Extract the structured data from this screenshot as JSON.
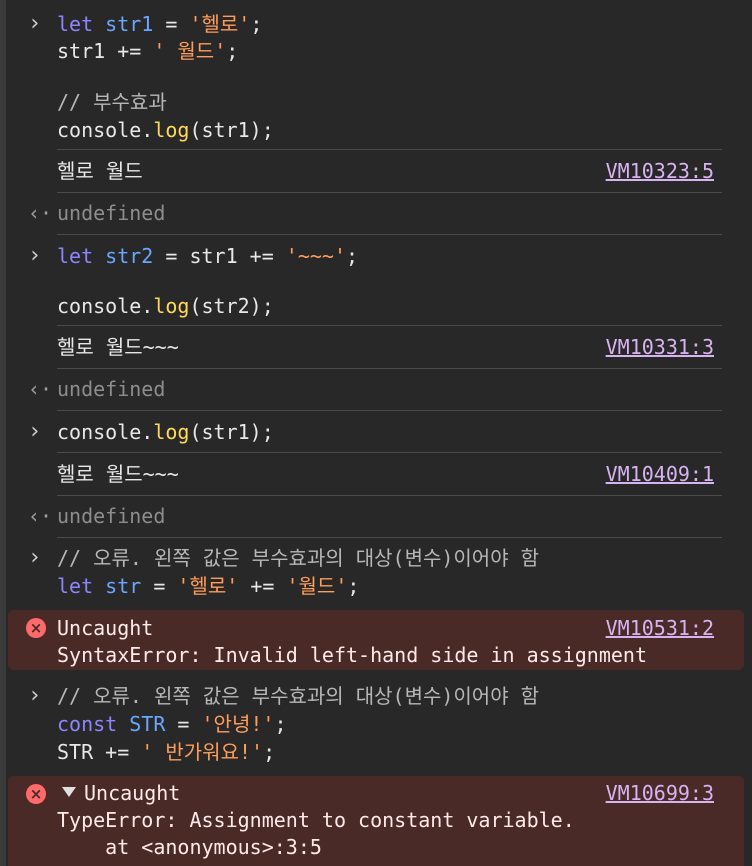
{
  "entries": [
    {
      "lines": [
        [
          [
            "let ",
            "kw"
          ],
          [
            "str1",
            "var"
          ],
          [
            " = ",
            ""
          ],
          [
            "'헬로'",
            "str"
          ],
          [
            ";",
            ""
          ]
        ],
        [
          [
            "str1 += ",
            ""
          ],
          [
            "' 월드'",
            "str"
          ],
          [
            ";",
            ""
          ]
        ],
        [
          [
            "",
            ""
          ]
        ],
        [
          [
            "// 부수효과",
            "cm"
          ]
        ],
        [
          [
            "console.",
            ""
          ],
          [
            "log",
            "fn"
          ],
          [
            "(str1);",
            ""
          ]
        ]
      ],
      "output": "헬로 월드",
      "source": "VM10323:5",
      "returned": "undefined"
    },
    {
      "lines": [
        [
          [
            "let ",
            "kw"
          ],
          [
            "str2",
            "var"
          ],
          [
            " = str1 += ",
            ""
          ],
          [
            "'~~~'",
            "str"
          ],
          [
            ";",
            ""
          ]
        ],
        [
          [
            "",
            ""
          ]
        ],
        [
          [
            "console.",
            ""
          ],
          [
            "log",
            "fn"
          ],
          [
            "(str2);",
            ""
          ]
        ]
      ],
      "output": "헬로 월드~~~",
      "source": "VM10331:3",
      "returned": "undefined"
    },
    {
      "lines": [
        [
          [
            "console.",
            ""
          ],
          [
            "log",
            "fn"
          ],
          [
            "(str1);",
            ""
          ]
        ]
      ],
      "output": "헬로 월드~~~",
      "source": "VM10409:1",
      "returned": "undefined"
    },
    {
      "lines": [
        [
          [
            "// 오류. 왼쪽 값은 부수효과의 대상(변수)이어야 함",
            "cm"
          ]
        ],
        [
          [
            "let ",
            "kw"
          ],
          [
            "str",
            "var"
          ],
          [
            " = ",
            ""
          ],
          [
            "'헬로'",
            "str"
          ],
          [
            " += ",
            ""
          ],
          [
            "'월드'",
            "str"
          ],
          [
            ";",
            ""
          ]
        ]
      ]
    },
    {
      "lines": [
        [
          [
            "// 오류. 왼쪽 값은 부수효과의 대상(변수)이어야 함",
            "cm"
          ]
        ],
        [
          [
            "const ",
            "kw"
          ],
          [
            "STR",
            "var"
          ],
          [
            " = ",
            ""
          ],
          [
            "'안녕!'",
            "str"
          ],
          [
            ";",
            ""
          ]
        ],
        [
          [
            "STR += ",
            ""
          ],
          [
            "' 반가워요!'",
            "str"
          ],
          [
            ";",
            ""
          ]
        ]
      ]
    }
  ],
  "errors": [
    {
      "title": "Uncaught",
      "source": "VM10531:2",
      "message": "SyntaxError: Invalid left-hand side in assignment",
      "stack": ""
    },
    {
      "title": "Uncaught",
      "source": "VM10699:3",
      "message": "TypeError: Assignment to constant variable.",
      "stack": "    at <anonymous>:3:5"
    }
  ],
  "icons": {
    "prompt": "chevron-right-icon",
    "return": "return-arrow-icon",
    "error": "error-circle-icon",
    "expand": "triangle-down-icon"
  },
  "colors": {
    "background": "#282828",
    "keyword": "#8f84ff",
    "variable": "#6aa7ff",
    "string": "#ff9d5c",
    "function": "#ffd95a",
    "link": "#d8b3f2",
    "error_bg": "#4a2a27"
  }
}
